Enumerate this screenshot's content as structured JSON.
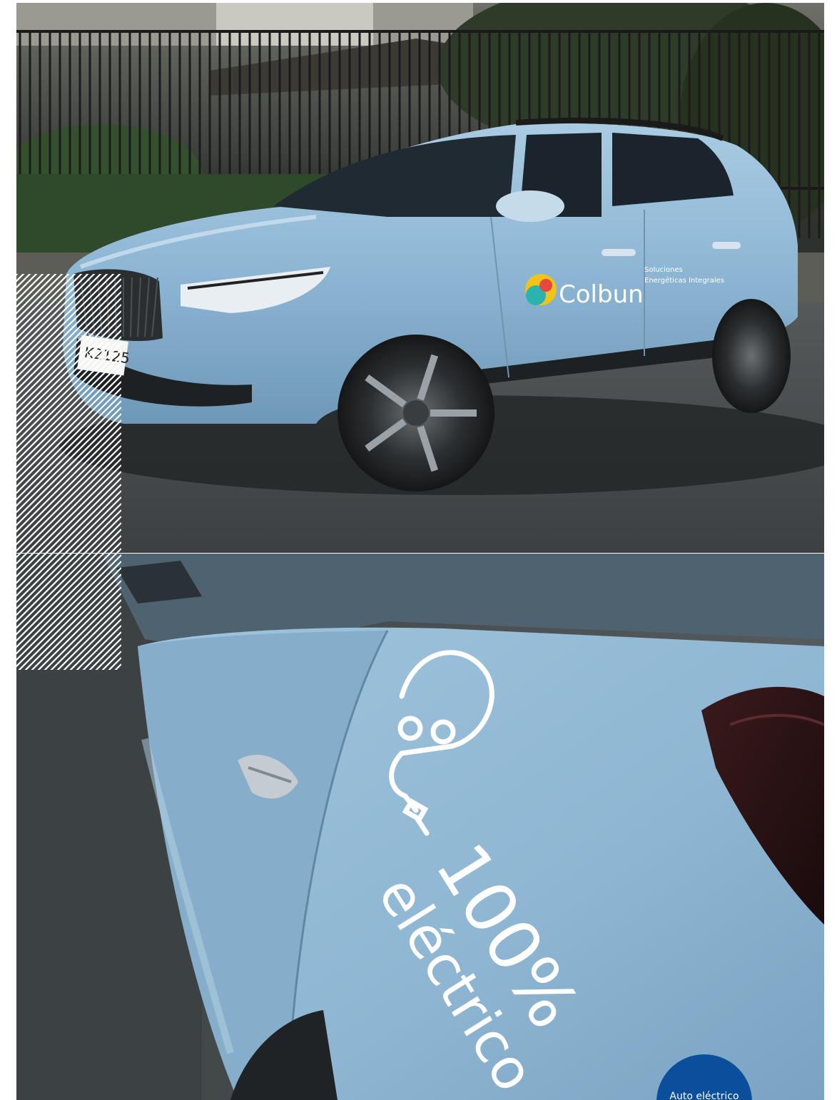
{
  "top_photo": {
    "brand_logo_text": "Colbun",
    "door_text_line1": "Soluciones",
    "door_text_line2": "Energéticas Integrales",
    "license_plate": "K2125"
  },
  "bottom_photo": {
    "decal_line1": "100%",
    "decal_line2": "eléctrico"
  },
  "badge": {
    "label": "Auto eléctrico",
    "color": "#0b4f9c"
  },
  "colors": {
    "car_body": "#8db6d4",
    "stripes": "#ffffff"
  }
}
